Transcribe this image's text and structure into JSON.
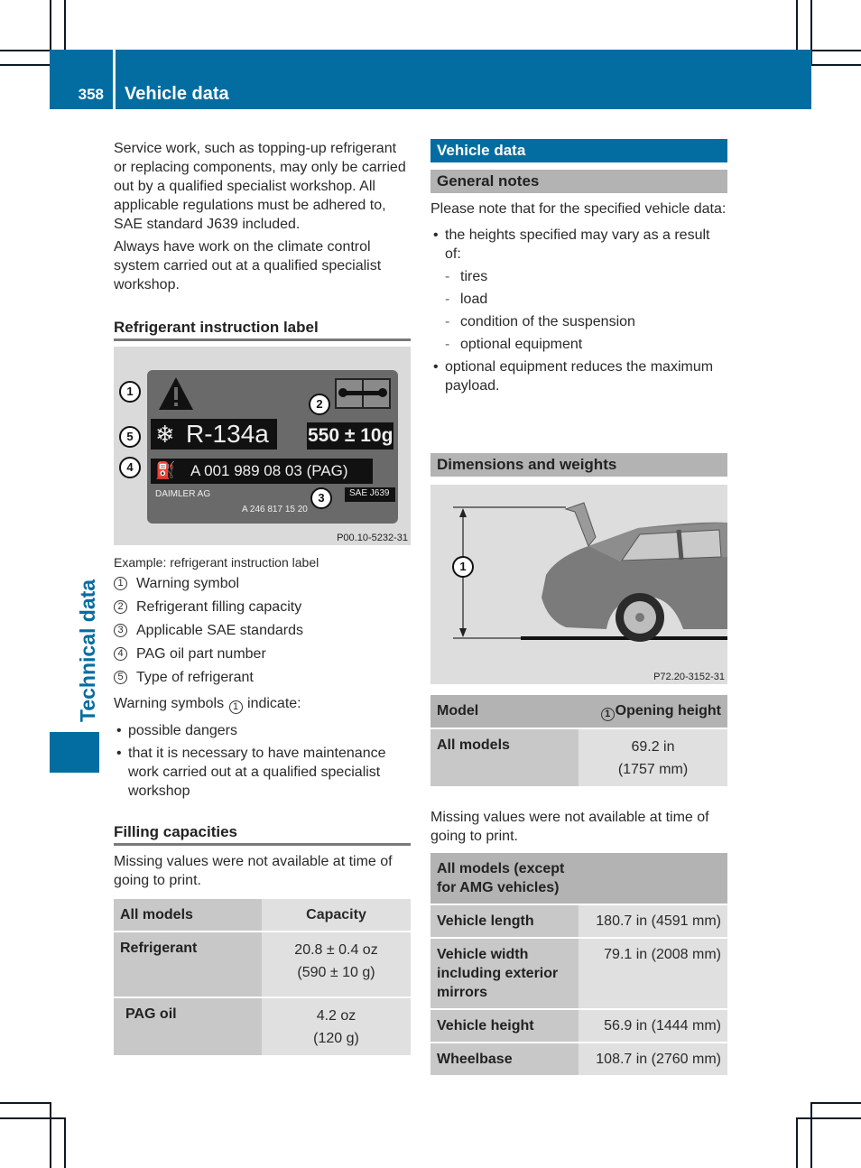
{
  "header": {
    "page_number": "358",
    "section_title": "Vehicle data"
  },
  "side_tab": {
    "label": "Technical data"
  },
  "colors": {
    "brand_blue": "#036da1",
    "bar_gray": "#b3b3b3",
    "label_gray": "#c8c8c8",
    "value_gray": "#e0e0e0"
  },
  "left": {
    "intro": [
      "Service work, such as topping-up refrigerant or replacing components, may only be carried out by a qualified specialist workshop. All applicable regulations must be adhered to, SAE standard J639 included.",
      "Always have work on the climate control system carried out at a qualified specialist workshop."
    ],
    "refrigerant_label": {
      "heading": "Refrigerant instruction label",
      "figure": {
        "refrigerant": "R-134a",
        "capacity": "550 ± 10g",
        "pag_part": "A 001 989 08 03 (PAG)",
        "maker": "DAIMLER AG",
        "sae": "SAE J639",
        "label_part": "A 246 817 15 20",
        "code": "P00.10-5232-31",
        "callouts": [
          "1",
          "2",
          "3",
          "4",
          "5"
        ]
      },
      "caption": "Example: refrigerant instruction label",
      "legend": [
        {
          "num": "1",
          "text": "Warning symbol"
        },
        {
          "num": "2",
          "text": "Refrigerant filling capacity"
        },
        {
          "num": "3",
          "text": "Applicable SAE standards"
        },
        {
          "num": "4",
          "text": "PAG oil part number"
        },
        {
          "num": "5",
          "text": "Type of refrigerant"
        }
      ],
      "warning_intro_before": "Warning symbols",
      "warning_intro_num": "1",
      "warning_intro_after": "indicate:",
      "warning_bullets": [
        "possible dangers",
        "that it is necessary to have maintenance work carried out at a qualified specialist workshop"
      ]
    },
    "filling": {
      "heading": "Filling capacities",
      "note": "Missing values were not available at time of going to print.",
      "table": {
        "headers": [
          "All models",
          "Capacity"
        ],
        "rows": [
          {
            "label": "Refrigerant",
            "line1": "20.8 ± 0.4 oz",
            "line2": "(590 ± 10 g)"
          },
          {
            "label": "PAG oil",
            "line1": "4.2 oz",
            "line2": "(120 g)"
          }
        ]
      }
    }
  },
  "right": {
    "section_bar": "Vehicle data",
    "general": {
      "heading": "General notes",
      "intro": "Please note that for the specified vehicle data:",
      "bullet1": "the heights specified may vary as a result of:",
      "sub_items": [
        "tires",
        "load",
        "condition of the suspension",
        "optional equipment"
      ],
      "bullet2": "optional equipment reduces the maximum payload."
    },
    "dimensions": {
      "heading": "Dimensions and weights",
      "figure": {
        "code": "P72.20-3152-31",
        "callout": "1"
      },
      "opening_table": {
        "header_model": "Model",
        "header_num": "1",
        "header_value": "Opening height",
        "row_label": "All models",
        "row_line1": "69.2 in",
        "row_line2": "(1757 mm)"
      },
      "note": "Missing values were not available at time of going to print.",
      "dims_table": {
        "header": "All models (except for AMG vehicles)",
        "rows": [
          {
            "label": "Vehicle length",
            "value": "180.7 in (4591 mm)"
          },
          {
            "label": "Vehicle width including exterior mirrors",
            "value": "79.1 in (2008 mm)"
          },
          {
            "label": "Vehicle height",
            "value": "56.9 in (1444 mm)"
          },
          {
            "label": "Wheelbase",
            "value": "108.7 in (2760 mm)"
          }
        ]
      }
    }
  }
}
